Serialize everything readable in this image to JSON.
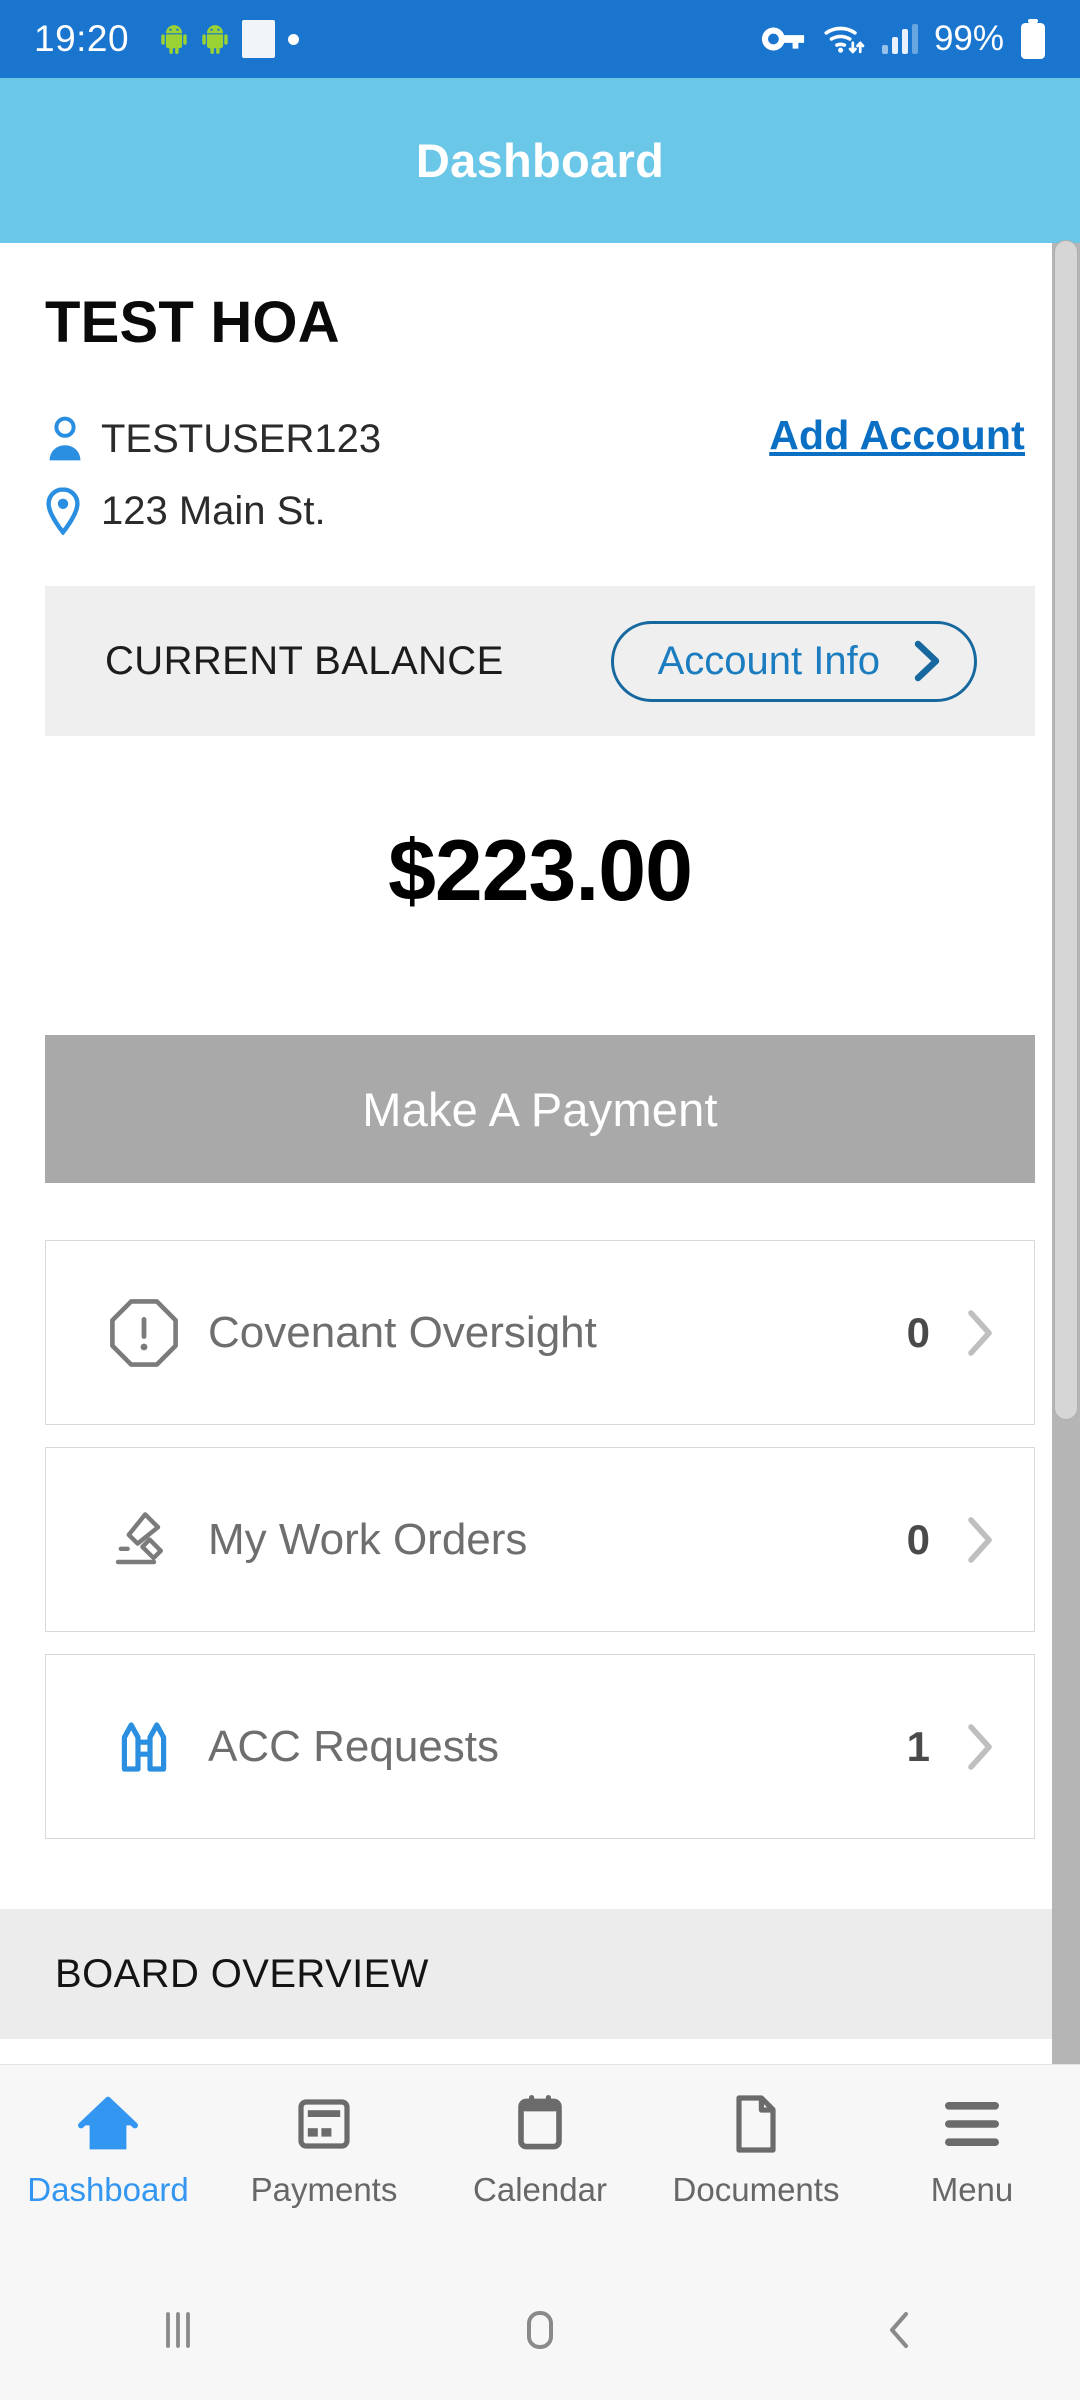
{
  "status_bar": {
    "time": "19:20",
    "battery_percent": "99%",
    "icons": [
      "android-robot-icon",
      "android-robot-icon",
      "white-square-icon",
      "dot-icon",
      "vpn-key-icon",
      "wifi-icon",
      "signal-bars-icon",
      "battery-icon"
    ]
  },
  "header": {
    "title": "Dashboard",
    "bg_color": "#6ac7e8"
  },
  "account": {
    "hoa_name": "TEST HOA",
    "username": "TESTUSER123",
    "address": "123 Main St.",
    "add_account_label": "Add Account",
    "add_account_color": "#0b6fc4"
  },
  "balance": {
    "label": "CURRENT BALANCE",
    "account_info_label": "Account Info",
    "amount": "$223.00"
  },
  "payment": {
    "button_label": "Make A Payment",
    "button_color": "#a9a9a9"
  },
  "cards": [
    {
      "icon": "alert-octagon-icon",
      "label": "Covenant  Oversight",
      "count": "0"
    },
    {
      "icon": "trowel-tool-icon",
      "label": "My Work Orders",
      "count": "0"
    },
    {
      "icon": "fence-gate-icon",
      "label": "ACC Requests",
      "count": "1"
    }
  ],
  "board_section": {
    "title": "BOARD OVERVIEW"
  },
  "tabs": [
    {
      "icon": "home-icon",
      "label": "Dashboard",
      "active": true
    },
    {
      "icon": "credit-card-icon",
      "label": "Payments",
      "active": false
    },
    {
      "icon": "calendar-icon",
      "label": "Calendar",
      "active": false
    },
    {
      "icon": "document-icon",
      "label": "Documents",
      "active": false
    },
    {
      "icon": "hamburger-icon",
      "label": "Menu",
      "active": false
    }
  ],
  "system_nav": {
    "recents": "recents-icon",
    "home": "home-square-icon",
    "back": "back-chevron-icon"
  },
  "colors": {
    "status_bar": "#1a75cf",
    "accent_blue": "#3396f0",
    "link_blue": "#0b6fc4"
  }
}
